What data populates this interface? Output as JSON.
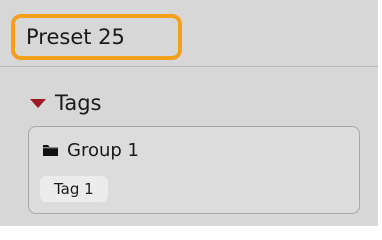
{
  "preset": {
    "title": "Preset 25",
    "highlight_color": "#f3a01c"
  },
  "tags_section": {
    "label": "Tags",
    "expanded": true,
    "toggle_icon": "triangle-down-icon",
    "toggle_color": "#9b1c24",
    "groups": [
      {
        "label": "Group 1",
        "icon": "folder-icon",
        "tags": [
          {
            "label": "Tag 1"
          }
        ]
      }
    ]
  }
}
